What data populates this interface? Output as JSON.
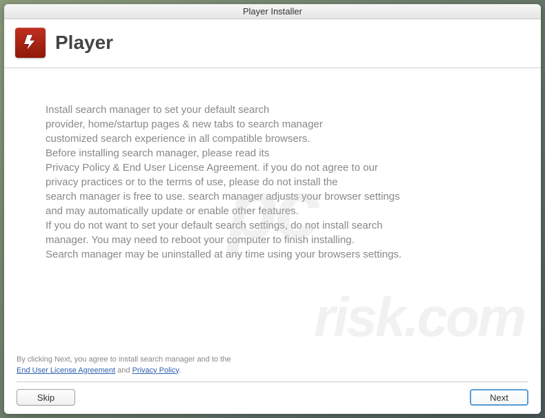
{
  "window": {
    "title": "Player Installer"
  },
  "header": {
    "title": "Player",
    "icon": "flash-icon"
  },
  "body": {
    "text": "Install search manager to set your default search\nprovider, home/startup pages & new tabs to search manager\ncustomized search experience in all compatible browsers.\nBefore installing search manager, please read its\nPrivacy Policy & End User License Agreement. if you do not agree to our\nprivacy practices or to the terms of use, please do not install the\nsearch manager is free to use. search manager adjusts your browser settings\nand may automatically update or enable other features.\nIf you do not want to set your default search settings, do not install search\nmanager. You may need to reboot your computer to finish installing.\nSearch manager may be uninstalled at any time using your browsers settings."
  },
  "footer": {
    "agreement_prefix": "By clicking Next, you agree to install search manager and to the",
    "eula_link": "End User License Agreement",
    "and": " and ",
    "privacy_link": "Privacy Policy",
    "period": "."
  },
  "buttons": {
    "skip": "Skip",
    "next": "Next"
  },
  "watermark": {
    "main": "pc",
    "sub": "risk.com"
  }
}
